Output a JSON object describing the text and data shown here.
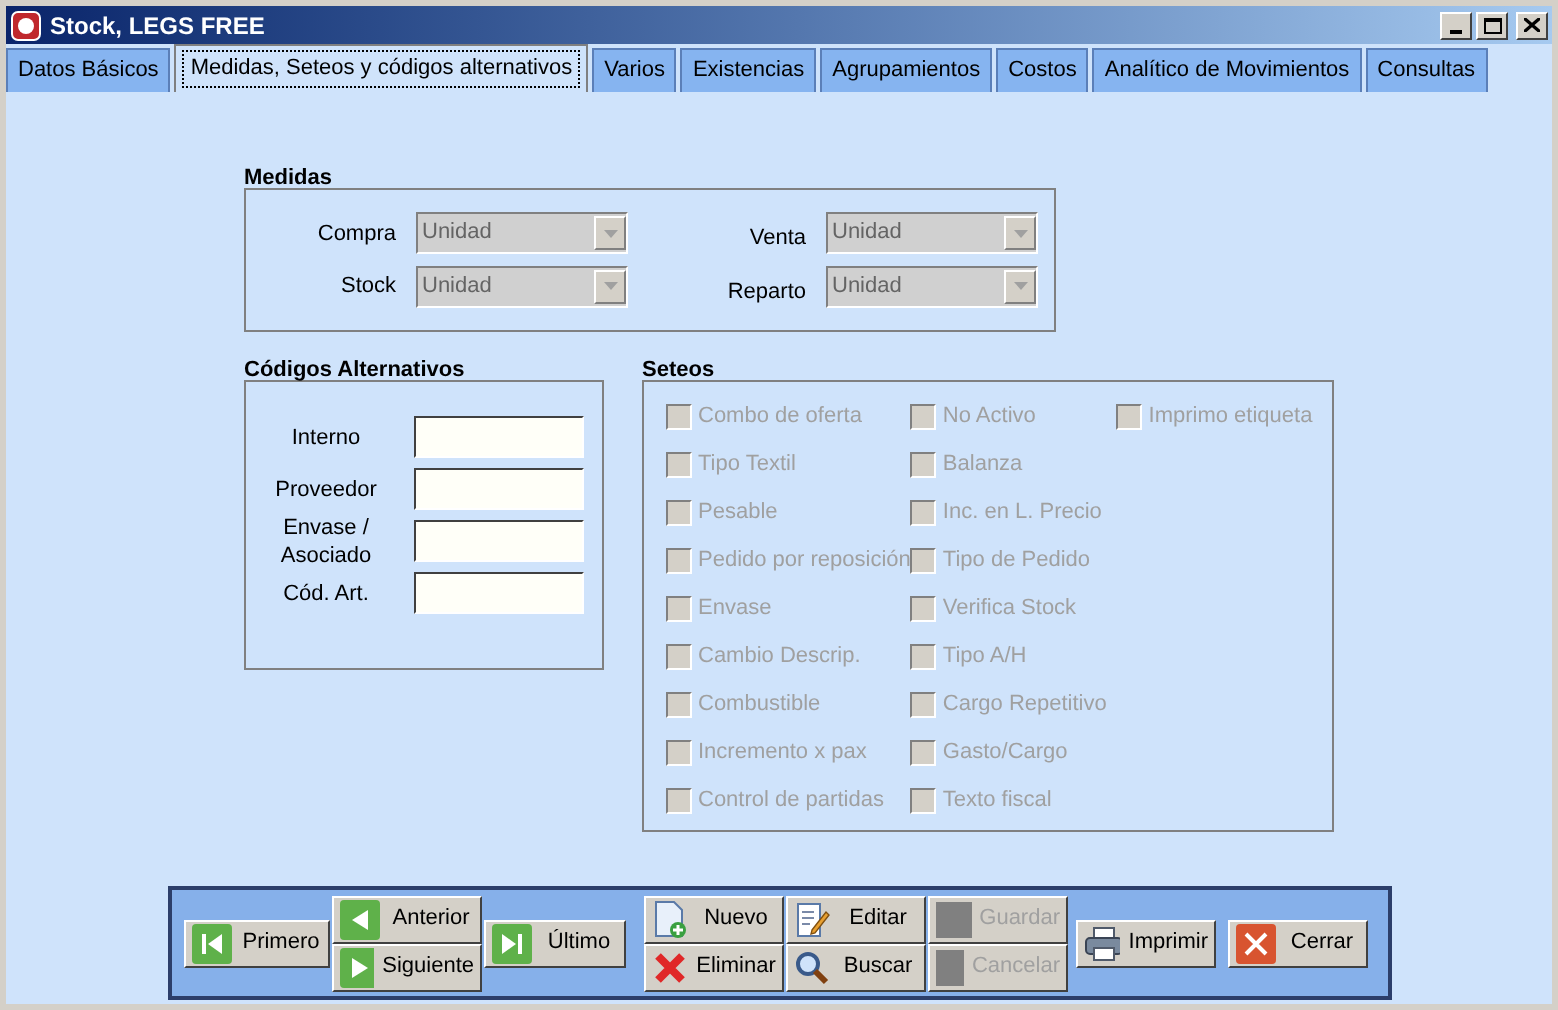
{
  "window": {
    "title": "Stock, LEGS FREE"
  },
  "tabs": [
    {
      "label": "Datos Básicos",
      "selected": false
    },
    {
      "label": "Medidas, Seteos y códigos alternativos",
      "selected": true
    },
    {
      "label": "Varios",
      "selected": false
    },
    {
      "label": "Existencias",
      "selected": false
    },
    {
      "label": "Agrupamientos",
      "selected": false
    },
    {
      "label": "Costos",
      "selected": false
    },
    {
      "label": "Analítico de Movimientos",
      "selected": false
    },
    {
      "label": "Consultas",
      "selected": false
    }
  ],
  "medidas": {
    "title": "Medidas",
    "fields": [
      {
        "label": "Compra",
        "value": "Unidad",
        "disabled": true
      },
      {
        "label": "Venta",
        "value": "Unidad",
        "disabled": true
      },
      {
        "label": "Stock",
        "value": "Unidad",
        "disabled": true
      },
      {
        "label": "Reparto",
        "value": "Unidad",
        "disabled": true
      }
    ]
  },
  "codigos": {
    "title": "Códigos Alternativos",
    "fields": [
      {
        "label": "Interno"
      },
      {
        "label": "Proveedor"
      },
      {
        "label": "Envase / Asociado"
      },
      {
        "label": "Cód. Art."
      }
    ]
  },
  "seteos": {
    "title": "Seteos",
    "columns": [
      [
        {
          "label": "Combo de oferta",
          "checked": false,
          "disabled": true
        },
        {
          "label": "Tipo Textil",
          "checked": false,
          "disabled": true
        },
        {
          "label": "Pesable",
          "checked": false,
          "disabled": true
        },
        {
          "label": "Pedido por reposición",
          "checked": false,
          "disabled": true
        },
        {
          "label": "Envase",
          "checked": false,
          "disabled": true
        },
        {
          "label": "Cambio Descrip.",
          "checked": false,
          "disabled": true
        },
        {
          "label": "Combustible",
          "checked": false,
          "disabled": true
        },
        {
          "label": "Incremento x pax",
          "checked": false,
          "disabled": true
        },
        {
          "label": "Control de partidas",
          "checked": false,
          "disabled": true
        }
      ],
      [
        {
          "label": "No Activo",
          "checked": false,
          "disabled": true
        },
        {
          "label": "Balanza",
          "checked": false,
          "disabled": true
        },
        {
          "label": "Inc. en L. Precio",
          "checked": false,
          "disabled": true
        },
        {
          "label": "Tipo de Pedido",
          "checked": false,
          "disabled": true
        },
        {
          "label": "Verifica Stock",
          "checked": false,
          "disabled": true
        },
        {
          "label": "Tipo A/H",
          "checked": false,
          "disabled": true
        },
        {
          "label": "Cargo Repetitivo",
          "checked": false,
          "disabled": true
        },
        {
          "label": "Gasto/Cargo",
          "checked": false,
          "disabled": true
        },
        {
          "label": "Texto fiscal",
          "checked": false,
          "disabled": true
        }
      ],
      [
        {
          "label": "Imprimo etiqueta",
          "checked": false,
          "disabled": true
        }
      ]
    ]
  },
  "toolbar": {
    "groups": [
      [
        {
          "label": "Primero",
          "kind": "first",
          "disabled": false
        }
      ],
      [
        {
          "label": "Anterior",
          "kind": "prev",
          "disabled": false
        },
        {
          "label": "Siguiente",
          "kind": "next",
          "disabled": false
        }
      ],
      [
        {
          "label": "Último",
          "kind": "last",
          "disabled": false
        }
      ],
      [
        {
          "label": "Nuevo",
          "kind": "new",
          "disabled": false
        },
        {
          "label": "Eliminar",
          "kind": "delete",
          "disabled": false
        }
      ],
      [
        {
          "label": "Editar",
          "kind": "edit",
          "disabled": false
        },
        {
          "label": "Buscar",
          "kind": "search",
          "disabled": false
        }
      ],
      [
        {
          "label": "Guardar",
          "kind": "save",
          "disabled": true
        },
        {
          "label": "Cancelar",
          "kind": "cancel",
          "disabled": true
        }
      ],
      [
        {
          "label": "Imprimir",
          "kind": "print",
          "disabled": false
        }
      ],
      [
        {
          "label": "Cerrar",
          "kind": "close",
          "disabled": false
        }
      ]
    ]
  }
}
